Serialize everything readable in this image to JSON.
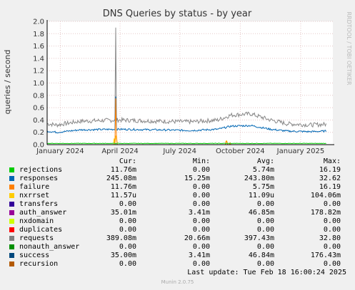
{
  "chart_data": {
    "type": "line",
    "title": "DNS Queries by status - by year",
    "ylabel": "queries / second",
    "side_text": "RRDTOOL / TOBI OETIKER",
    "ylim": [
      0,
      2.0
    ],
    "yticks": [
      "0.0",
      "0.2",
      "0.4",
      "0.6",
      "0.8",
      "1.0",
      "1.2",
      "1.4",
      "1.6",
      "1.8",
      "2.0"
    ],
    "xticks": [
      {
        "label": "January 2024",
        "x": 0
      },
      {
        "label": "April 2024",
        "x": 91
      },
      {
        "label": "July 2024",
        "x": 182
      },
      {
        "label": "October 2024",
        "x": 274
      },
      {
        "label": "January 2025",
        "x": 366
      }
    ],
    "xlim": [
      -20,
      415
    ],
    "series": [
      {
        "name": "requests",
        "color": "#888888",
        "baseline": 0.36,
        "noise": 0.035,
        "points": [
          [
            -20,
            0.34
          ],
          [
            -5,
            0.32
          ],
          [
            30,
            0.38
          ],
          [
            90,
            0.4
          ],
          [
            150,
            0.38
          ],
          [
            200,
            0.37
          ],
          [
            240,
            0.4
          ],
          [
            260,
            0.48
          ],
          [
            290,
            0.5
          ],
          [
            320,
            0.4
          ],
          [
            345,
            0.34
          ],
          [
            380,
            0.32
          ],
          [
            405,
            0.33
          ]
        ],
        "spikes": [
          [
            84,
            1.9
          ]
        ]
      },
      {
        "name": "responses",
        "color": "#0066b3",
        "noise": 0.015,
        "points": [
          [
            -20,
            0.22
          ],
          [
            -5,
            0.2
          ],
          [
            30,
            0.24
          ],
          [
            90,
            0.25
          ],
          [
            150,
            0.24
          ],
          [
            200,
            0.23
          ],
          [
            240,
            0.25
          ],
          [
            260,
            0.3
          ],
          [
            290,
            0.31
          ],
          [
            320,
            0.25
          ],
          [
            345,
            0.22
          ],
          [
            380,
            0.21
          ],
          [
            405,
            0.22
          ]
        ],
        "spikes": [
          [
            84,
            0.78
          ]
        ]
      },
      {
        "name": "nxrrset",
        "color": "#ffcc00",
        "noise": 0,
        "points": [
          [
            -20,
            0
          ],
          [
            405,
            0
          ]
        ],
        "spikes": [
          [
            82,
            0.1
          ],
          [
            85,
            0.14
          ],
          [
            253,
            0.06
          ]
        ]
      },
      {
        "name": "failure",
        "color": "#ff8000",
        "noise": 0,
        "points": [
          [
            -20,
            0
          ],
          [
            405,
            0
          ]
        ],
        "spikes": [
          [
            84,
            0.75
          ],
          [
            86,
            0.1
          ],
          [
            253,
            0.05
          ],
          [
            258,
            0.03
          ]
        ]
      },
      {
        "name": "success",
        "color": "#00cc00",
        "noise": 0.004,
        "points": [
          [
            -20,
            0.02
          ],
          [
            405,
            0.02
          ]
        ],
        "spikes": []
      }
    ]
  },
  "legend": {
    "headers": [
      "Cur:",
      "Min:",
      "Avg:",
      "Max:"
    ],
    "rows": [
      {
        "name": "rejections",
        "color": "#00cc00",
        "cur": "11.76m",
        "min": "0.00",
        "avg": "5.74m",
        "max": "16.19"
      },
      {
        "name": "responses",
        "color": "#0066b3",
        "cur": "245.08m",
        "min": "15.25m",
        "avg": "243.80m",
        "max": "32.62"
      },
      {
        "name": "failure",
        "color": "#ff8000",
        "cur": "11.76m",
        "min": "0.00",
        "avg": "5.75m",
        "max": "16.19"
      },
      {
        "name": "nxrrset",
        "color": "#ffcc00",
        "cur": "11.57u",
        "min": "0.00",
        "avg": "11.09u",
        "max": "104.06m"
      },
      {
        "name": "transfers",
        "color": "#330099",
        "cur": "0.00",
        "min": "0.00",
        "avg": "0.00",
        "max": "0.00"
      },
      {
        "name": "auth_answer",
        "color": "#990099",
        "cur": "35.01m",
        "min": "3.41m",
        "avg": "46.85m",
        "max": "178.82m"
      },
      {
        "name": "nxdomain",
        "color": "#ccff00",
        "cur": "0.00",
        "min": "0.00",
        "avg": "0.00",
        "max": "0.00"
      },
      {
        "name": "duplicates",
        "color": "#ff0000",
        "cur": "0.00",
        "min": "0.00",
        "avg": "0.00",
        "max": "0.00"
      },
      {
        "name": "requests",
        "color": "#808080",
        "cur": "389.08m",
        "min": "20.66m",
        "avg": "397.43m",
        "max": "32.80"
      },
      {
        "name": "nonauth_answer",
        "color": "#008f00",
        "cur": "0.00",
        "min": "0.00",
        "avg": "0.00",
        "max": "0.00"
      },
      {
        "name": "success",
        "color": "#00487d",
        "cur": "35.00m",
        "min": "3.41m",
        "avg": "46.84m",
        "max": "176.43m"
      },
      {
        "name": "recursion",
        "color": "#b35a00",
        "cur": "0.00",
        "min": "0.00",
        "avg": "0.00",
        "max": "0.00"
      }
    ]
  },
  "footer": {
    "last_update": "Last update: Tue Feb 18 16:00:24 2025",
    "munin": "Munin 2.0.75"
  }
}
